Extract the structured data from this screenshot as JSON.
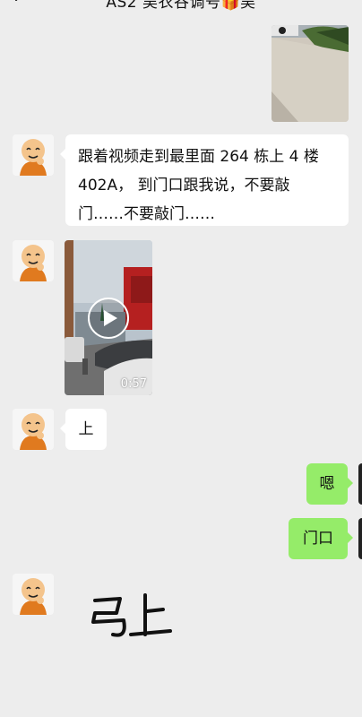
{
  "header": {
    "title": "AS2 吴衣谷调号🎁吴",
    "back_icon": "chevron-left-icon"
  },
  "colors": {
    "background": "#ededed",
    "incoming_bubble": "#ffffff",
    "outgoing_bubble": "#95ec69"
  },
  "messages": [
    {
      "sender": "self",
      "type": "image",
      "content": "photo of sidewalk and plants"
    },
    {
      "sender": "contact",
      "type": "text",
      "lines": [
        "跟着视频走到最里面 264 栋上 4 楼",
        "402A， 到门口跟我说，不要敲",
        "门……不要敲门……"
      ]
    },
    {
      "sender": "contact",
      "type": "video",
      "duration": "0:57"
    },
    {
      "sender": "contact",
      "type": "text",
      "text": "上"
    },
    {
      "sender": "self",
      "type": "text",
      "text": "嗯"
    },
    {
      "sender": "self",
      "type": "text",
      "text": "门口"
    },
    {
      "sender": "contact",
      "type": "handwriting",
      "text": "马上"
    }
  ]
}
